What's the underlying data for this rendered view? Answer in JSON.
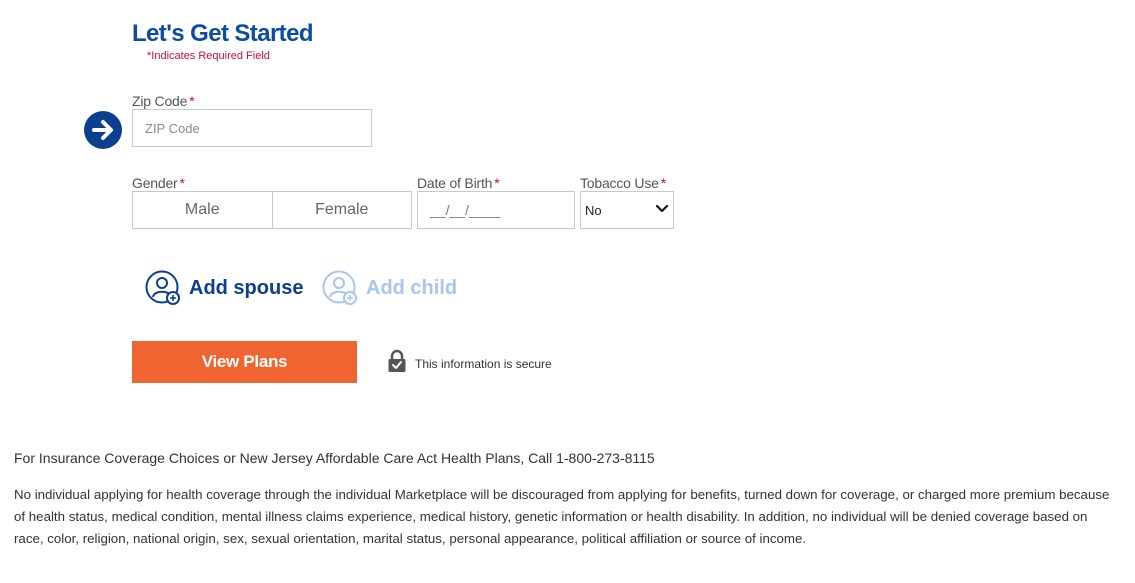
{
  "header": {
    "title": "Let's Get Started",
    "required_note": "*Indicates Required Field"
  },
  "form": {
    "zip": {
      "label": "Zip Code",
      "required": "*",
      "placeholder": "ZIP Code",
      "value": ""
    },
    "gender": {
      "label": "Gender",
      "required": "*",
      "options": [
        "Male",
        "Female"
      ]
    },
    "dob": {
      "label": "Date of Birth",
      "required": "*",
      "placeholder": "__/__/____"
    },
    "tobacco": {
      "label": "Tobacco Use",
      "required": "*",
      "selected": "No"
    }
  },
  "household": {
    "add_spouse": "Add spouse",
    "add_child": "Add child"
  },
  "actions": {
    "view_plans": "View Plans",
    "secure_text": "This information is secure"
  },
  "footer": {
    "call_text": "For Insurance Coverage Choices or New Jersey Affordable Care Act Health Plans, Call 1-800-273-8115",
    "disclaimer": "No individual applying for health coverage through the individual Marketplace will be discouraged from applying for benefits, turned down for coverage, or charged more premium because of health status, medical condition, mental illness claims experience, medical history, genetic information or health disability. In addition, no individual will be denied coverage based on race, color, religion, national origin, sex, sexual orientation, marital status, personal appearance, political affiliation or source of income."
  },
  "colors": {
    "brand_blue": "#0b4da2",
    "arrow_blue": "#0d3f8f",
    "required_red": "#c8102e",
    "cta_orange": "#ef6430",
    "disabled_blue": "#a9c6ec"
  },
  "icons": [
    "arrow-right-icon",
    "add-person-icon",
    "lock-icon",
    "chevron-down-icon"
  ]
}
